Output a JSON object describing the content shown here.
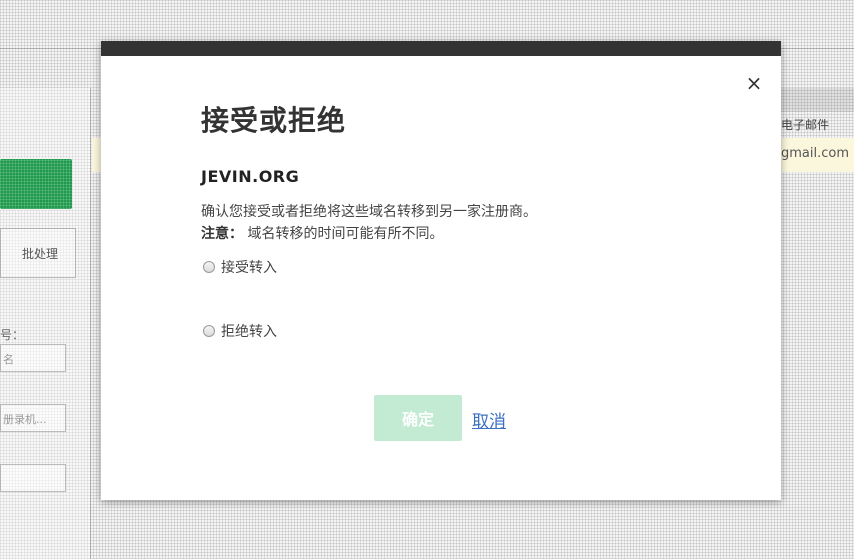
{
  "background": {
    "batch_button_label": "批处理",
    "field_label": "号：",
    "input1_placeholder": "名",
    "input2_placeholder": "册录机...",
    "right_header_text": "电子邮件",
    "right_email_fragment": "gmail.com"
  },
  "modal": {
    "close_icon": "×",
    "title": "接受或拒绝",
    "domain": "JEVIN.ORG",
    "description": "确认您接受或者拒绝将这些域名转移到另一家注册商。",
    "note_label": "注意：",
    "note_text": " 域名转移的时间可能有所不同。",
    "options": [
      {
        "label": "接受转入",
        "checked": false
      },
      {
        "label": "拒绝转入",
        "checked": false
      }
    ],
    "confirm_label": "确定",
    "cancel_label": "取消"
  },
  "colors": {
    "topbar": "#333333",
    "confirm_disabled": "#c3ead3",
    "link": "#3a6fc1",
    "bg_green": "#1f9a4d"
  }
}
